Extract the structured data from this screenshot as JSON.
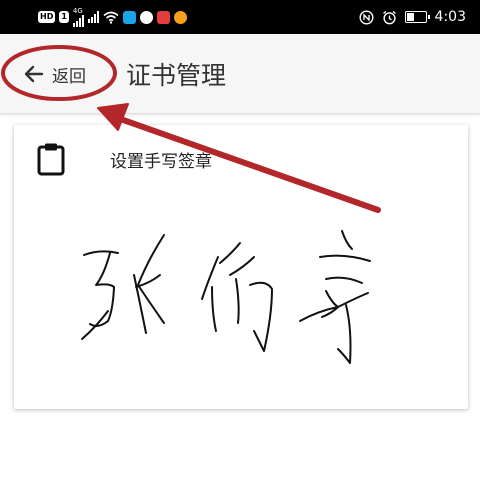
{
  "status_bar": {
    "hd_badge": "HD",
    "sim_badge": "1",
    "network_label": "4G",
    "time": "4:03",
    "battery_level": 0.35,
    "icons": [
      "signal-icon",
      "signal-x-icon",
      "wifi-icon",
      "search-app-icon",
      "browser-app-icon",
      "red-app-icon",
      "weibo-app-icon",
      "nfc-icon",
      "alarm-icon",
      "battery-icon"
    ]
  },
  "app_bar": {
    "back_label": "返回",
    "title": "证书管理",
    "background": "#f6f6f6"
  },
  "card": {
    "title": "设置手写签章",
    "icon": "clipboard-icon"
  },
  "annotation": {
    "color": "#b3262a",
    "shapes": [
      "ellipse-around-back-button",
      "arrow-pointing-to-back-button"
    ]
  }
}
